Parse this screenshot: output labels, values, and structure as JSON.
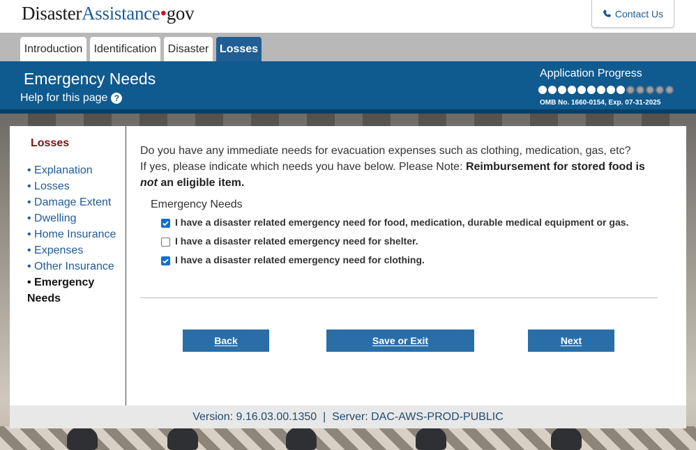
{
  "header": {
    "logo_part1": "Disaster",
    "logo_part2": "Assistance",
    "logo_dot": "•",
    "logo_part3": "gov",
    "contact_label": "Contact Us",
    "contact_icon": "phone-icon"
  },
  "tabs": [
    {
      "label": "Introduction",
      "active": false
    },
    {
      "label": "Identification",
      "active": false
    },
    {
      "label": "Disaster",
      "active": false
    },
    {
      "label": "Losses",
      "active": true
    }
  ],
  "banner": {
    "page_title": "Emergency Needs",
    "help_label": "Help for this page",
    "help_icon": "question-circle-icon",
    "progress_title": "Application Progress",
    "progress_total_steps": 14,
    "progress_completed_steps": 9,
    "omb_text": "OMB No. 1660-0154, Exp. 07-31-2025"
  },
  "sidebar": {
    "title": "Losses",
    "items": [
      {
        "label": "• Explanation",
        "current": false
      },
      {
        "label": "• Losses",
        "current": false
      },
      {
        "label": "• Damage Extent",
        "current": false
      },
      {
        "label": "• Dwelling",
        "current": false
      },
      {
        "label": "• Home Insurance",
        "current": false
      },
      {
        "label": "• Expenses",
        "current": false
      },
      {
        "label": "• Other Insurance",
        "current": false
      },
      {
        "label": "• Emergency Needs",
        "current": true
      }
    ]
  },
  "main": {
    "question_line1": "Do you have any immediate needs for evacuation expenses such as clothing, medication, gas, etc?",
    "question_line2_start": "If yes, please indicate which needs you have below. Please Note: ",
    "question_bold": "Reimbursement for stored food is ",
    "question_italic": "not",
    "question_bold_end": " an eligible item.",
    "fieldset_legend": "Emergency Needs",
    "options": [
      {
        "label": "I have a disaster related emergency need for food, medication, durable medical equipment or gas.",
        "checked": true
      },
      {
        "label": "I have a disaster related emergency need for shelter.",
        "checked": false
      },
      {
        "label": "I have a disaster related emergency need for clothing.",
        "checked": true
      }
    ]
  },
  "buttons": {
    "back": "Back",
    "save": "Save or Exit",
    "next": "Next"
  },
  "footer": {
    "text": "Version: 9.16.03.00.1350  |  Server: DAC-AWS-PROD-PUBLIC"
  },
  "colors": {
    "banner": "#0f5a8e",
    "button": "#2a6ea8",
    "sidebar_title": "#7b1010",
    "link": "#1e5b9a"
  }
}
